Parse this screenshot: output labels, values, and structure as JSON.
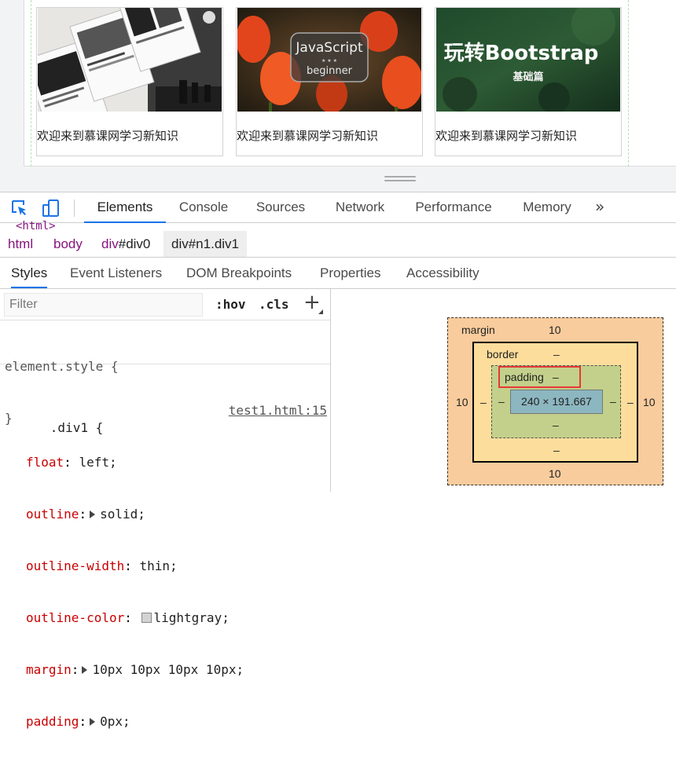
{
  "preview": {
    "cards": [
      {
        "caption": "欢迎来到慕课网学习新知识",
        "image": "fashion-magazine-photo"
      },
      {
        "caption": "欢迎来到慕课网学习新知识",
        "image": "javascript-beginner-tulips",
        "image_title": "JavaScript",
        "image_subtitle": "beginner"
      },
      {
        "caption": "欢迎来到慕课网学习新知识",
        "image": "bootstrap-green-banner",
        "image_title": "玩转Bootstrap",
        "image_subtitle": "基础篇"
      }
    ]
  },
  "devtools": {
    "tabs": [
      "Elements",
      "Console",
      "Sources",
      "Network",
      "Performance",
      "Memory"
    ],
    "active_tab": "Elements",
    "more_tabs_label": "»",
    "html_peek": "<html>",
    "breadcrumb": {
      "html": "html",
      "body": "body",
      "div0_tag": "div",
      "div0_id": "#div0",
      "selected": "div#n1.div1"
    },
    "sidebar_tabs": [
      "Styles",
      "Event Listeners",
      "DOM Breakpoints",
      "Properties",
      "Accessibility"
    ],
    "active_sidebar_tab": "Styles",
    "styles": {
      "filter_placeholder": "Filter",
      "hov": ":hov",
      "cls": ".cls",
      "add": "+",
      "element_style_open": "element.style {",
      "element_style_close": "}",
      "rule_selector": ".div1",
      "rule_open": " {",
      "rule_source": "test1.html:15",
      "properties": [
        {
          "name": "float",
          "value": "left;",
          "expandable": false
        },
        {
          "name": "outline",
          "value": "solid;",
          "expandable": true
        },
        {
          "name": "outline-width",
          "value": "thin;",
          "expandable": false
        },
        {
          "name": "outline-color",
          "value": "lightgray;",
          "expandable": false,
          "swatch": "#d3d3d3"
        },
        {
          "name": "margin",
          "value": "10px 10px 10px 10px;",
          "expandable": true
        },
        {
          "name": "padding",
          "value": "0px;",
          "expandable": true
        }
      ]
    },
    "box_model": {
      "margin_label": "margin",
      "margin_top": "10",
      "margin_bottom": "10",
      "margin_left": "10",
      "margin_right": "10",
      "border_label": "border",
      "border_top": "–",
      "border_bottom": "–",
      "border_left": "–",
      "border_right": "–",
      "padding_label": "padding",
      "padding_top": "–",
      "padding_bottom": "–",
      "padding_left": "–",
      "padding_right": "–",
      "content": "240 × 191.667",
      "colors": {
        "margin": "#f9cc9d",
        "border": "#fddd9b",
        "padding": "#c3d08b",
        "content": "#8cb6c0",
        "highlight": "#e53935"
      }
    },
    "colors": {
      "accent": "#1a73e8",
      "tag": "#881280",
      "property": "#c80000"
    }
  }
}
